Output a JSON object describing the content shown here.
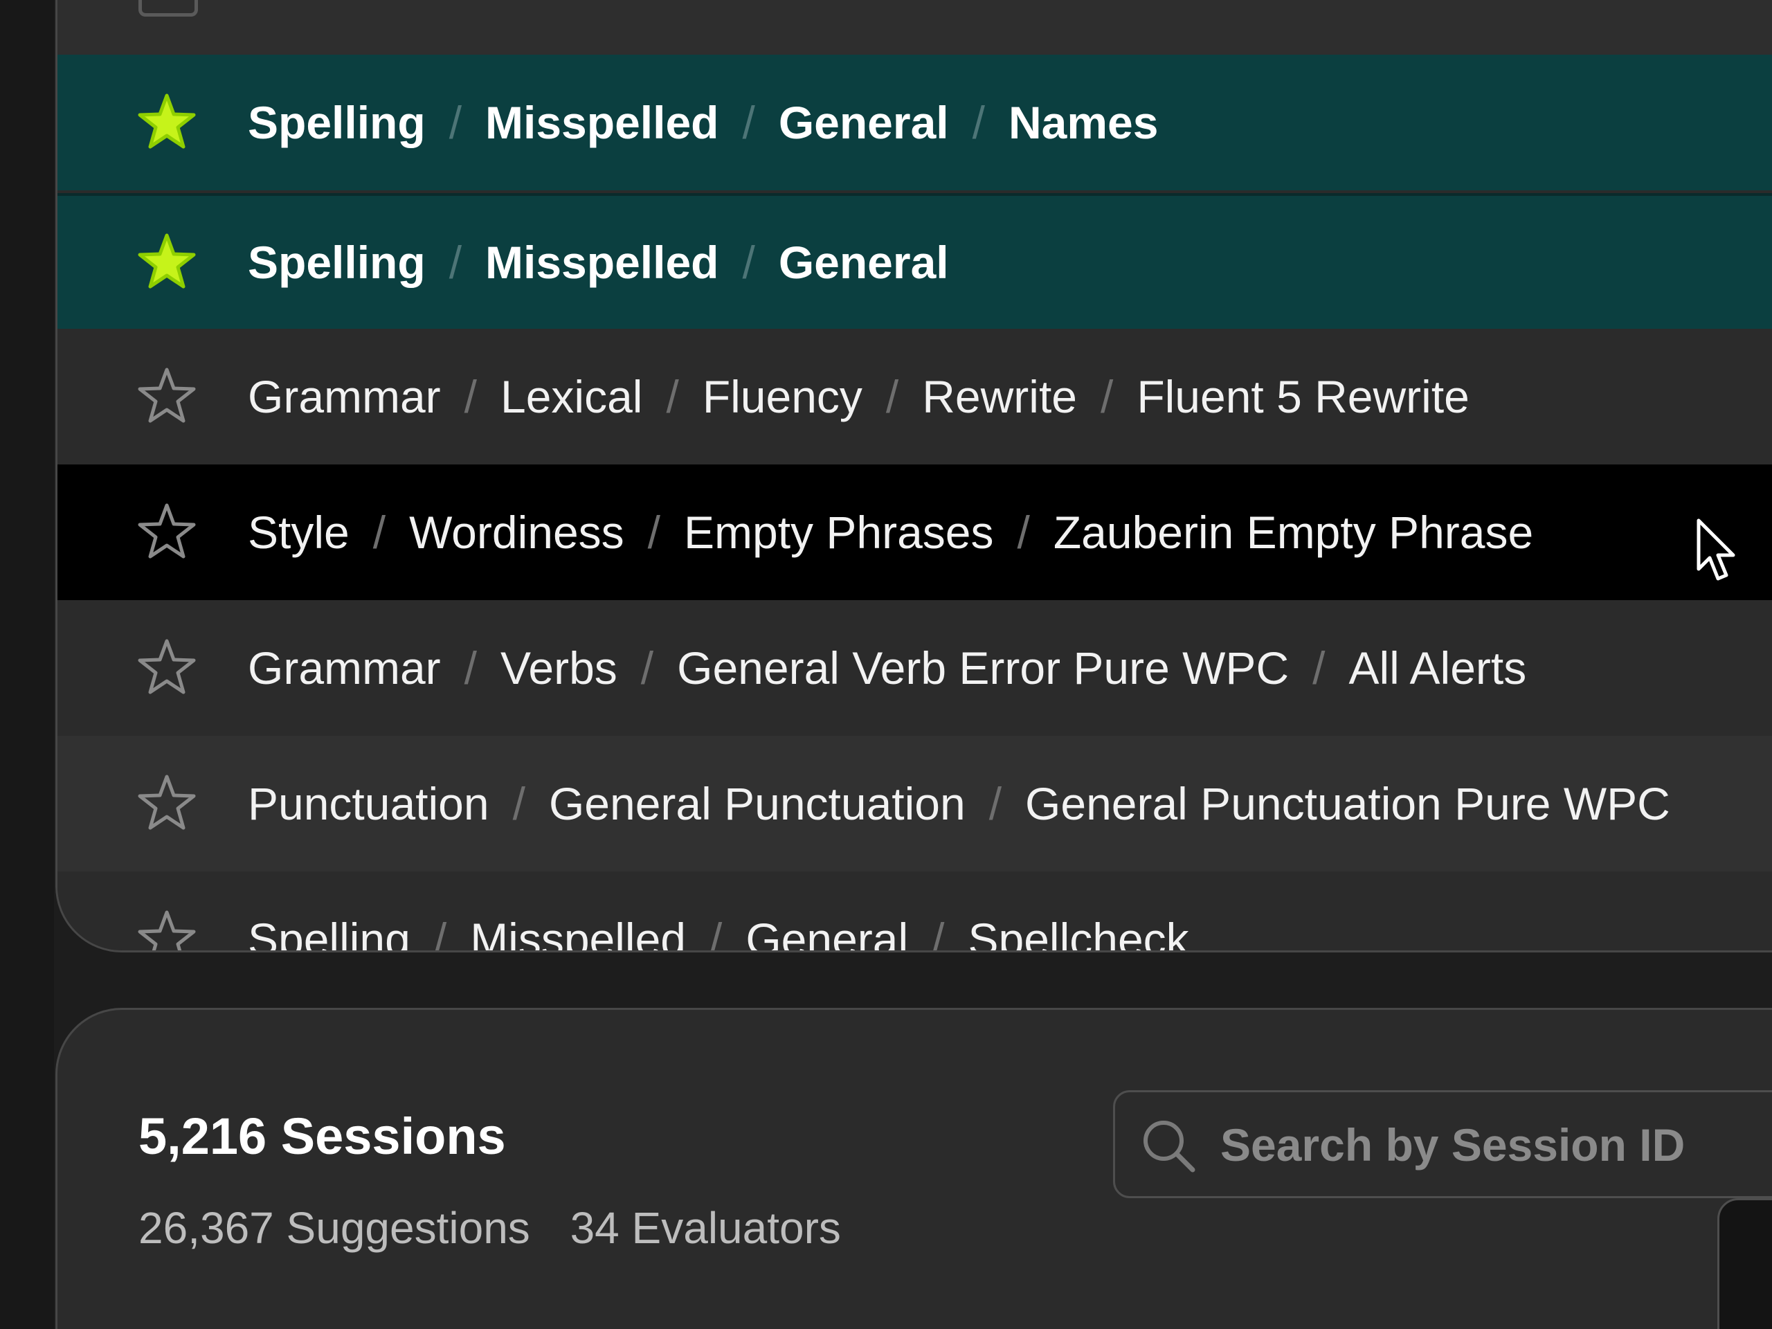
{
  "rule_list": {
    "rows": [
      {
        "starred": true,
        "state": "selected",
        "path": [
          "Spelling",
          "Misspelled",
          "General",
          "Names"
        ]
      },
      {
        "starred": true,
        "state": "selected",
        "path": [
          "Spelling",
          "Misspelled",
          "General"
        ]
      },
      {
        "starred": false,
        "state": "default",
        "path": [
          "Grammar",
          "Lexical",
          "Fluency",
          "Rewrite",
          "Fluent 5 Rewrite"
        ]
      },
      {
        "starred": false,
        "state": "hovered",
        "path": [
          "Style",
          "Wordiness",
          "Empty Phrases",
          "Zauberin Empty Phrase"
        ]
      },
      {
        "starred": false,
        "state": "default",
        "path": [
          "Grammar",
          "Verbs",
          "General Verb Error Pure WPC",
          "All Alerts"
        ]
      },
      {
        "starred": false,
        "state": "default",
        "path": [
          "Punctuation",
          "General Punctuation",
          "General Punctuation Pure WPC"
        ]
      },
      {
        "starred": false,
        "state": "default",
        "path": [
          "Spelling",
          "Misspelled",
          "General",
          "Spellcheck"
        ]
      }
    ],
    "separator": "/"
  },
  "sessions": {
    "title": "5,216 Sessions",
    "suggestions": "26,367 Suggestions",
    "evaluators": "34 Evaluators",
    "search": {
      "placeholder": "Search by Session ID",
      "value": ""
    }
  },
  "colors": {
    "selected_row": "#0b3f40",
    "hovered_row": "#000000",
    "star_filled": "#c6f31a",
    "star_outline": "#8a8a8a",
    "panel_bg": "#2b2b2b"
  },
  "icons": {
    "star": "star-icon",
    "search": "search-icon",
    "cursor": "mouse-pointer-icon"
  }
}
